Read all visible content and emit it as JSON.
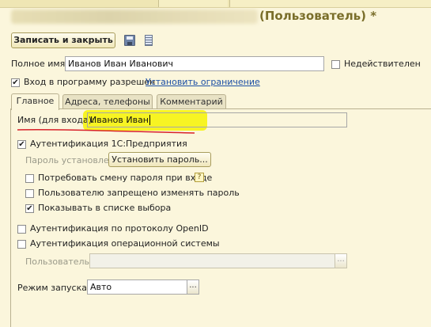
{
  "window": {
    "title_suffix": "(Пользователь) *"
  },
  "toolbar": {
    "save_close_label": "Записать и закрыть",
    "save_icon": "floppy-disk-icon",
    "list_icon": "list-icon"
  },
  "user": {
    "full_name_label": "Полное имя:",
    "full_name_value": "Иванов Иван Иванович",
    "inactive_label": "Недействителен",
    "inactive_checked": false,
    "login_allowed_label": "Вход в программу разрешен",
    "login_allowed_checked": true,
    "set_restriction_link": "Установить ограничение"
  },
  "tabs": [
    {
      "label": "Главное",
      "active": true
    },
    {
      "label": "Адреса, телефоны",
      "active": false
    },
    {
      "label": "Комментарий",
      "active": false
    }
  ],
  "main": {
    "login_name_label": "Имя (для входа):",
    "login_name_value": "Иванов Иван",
    "auth_1c_label": "Аутентификация 1С:Предприятия",
    "auth_1c_checked": true,
    "password_set_label": "Пароль установлен",
    "set_password_button": "Установить пароль...",
    "require_change_label": "Потребовать смену пароля при входе",
    "require_change_checked": false,
    "help_glyph": "?",
    "forbid_change_label": "Пользователю запрещено изменять пароль",
    "forbid_change_checked": false,
    "show_in_list_label": "Показывать в списке выбора",
    "show_in_list_checked": true,
    "openid_label": "Аутентификация по протоколу OpenID",
    "openid_checked": false,
    "os_auth_label": "Аутентификация операционной системы",
    "os_auth_checked": false,
    "os_user_label": "Пользователь:",
    "os_user_value": "",
    "launch_mode_label": "Режим запуска:",
    "launch_mode_value": "Авто",
    "ellipsis": "..."
  },
  "colors": {
    "background": "#fbf6dc",
    "highlight": "#f7f318",
    "underline_annotation": "#d8222a",
    "link": "#1b4fa5"
  }
}
